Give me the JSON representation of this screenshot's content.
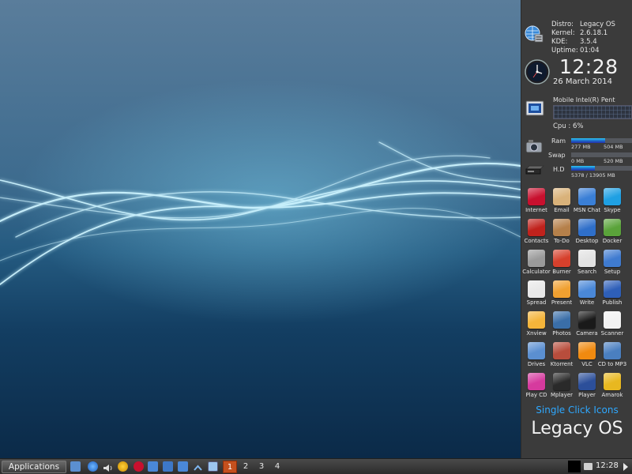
{
  "sysinfo": {
    "distro_label": "Distro:",
    "distro_value": "Legacy OS",
    "kernel_label": "Kernel:",
    "kernel_value": "2.6.18.1",
    "kde_label": "KDE:",
    "kde_value": "3.5.4",
    "uptime_label": "Uptime:",
    "uptime_value": "01:04"
  },
  "clock": {
    "time": "12:28",
    "date": "26 March 2014"
  },
  "cpu": {
    "name": "Mobile Intel(R) Pent",
    "label": "Cpu : 6%",
    "usage_percent": 6
  },
  "memory": {
    "ram": {
      "label": "Ram",
      "used": "277 MB",
      "total": "504 MB",
      "fraction": 0.55
    },
    "swap": {
      "label": "Swap",
      "used": "0 MB",
      "total": "520 MB",
      "fraction": 0.0
    },
    "hd": {
      "label": "H.D",
      "value": "5378 / 13905 MB",
      "fraction": 0.39
    }
  },
  "apps": [
    {
      "label": "Internet",
      "icon": "opera-icon",
      "color": "#c8102e"
    },
    {
      "label": "Email",
      "icon": "email-icon",
      "color": "#d9b27a"
    },
    {
      "label": "MSN Chat",
      "icon": "msn-icon",
      "color": "#3a7fd6"
    },
    {
      "label": "Skype",
      "icon": "skype-icon",
      "color": "#1fa0e3"
    },
    {
      "label": "Contacts",
      "icon": "contacts-icon",
      "color": "#c0221c"
    },
    {
      "label": "To-Do",
      "icon": "todo-icon",
      "color": "#b5804a"
    },
    {
      "label": "Desktop",
      "icon": "desktop-icon",
      "color": "#2f6fc9"
    },
    {
      "label": "Docker",
      "icon": "docker-icon",
      "color": "#5aa33a"
    },
    {
      "label": "Calculator",
      "icon": "calculator-icon",
      "color": "#9a9a9a"
    },
    {
      "label": "Burner",
      "icon": "burner-icon",
      "color": "#d6402c"
    },
    {
      "label": "Search",
      "icon": "search-icon",
      "color": "#e2e2e2"
    },
    {
      "label": "Setup",
      "icon": "setup-icon",
      "color": "#3f7bd0"
    },
    {
      "label": "Spread",
      "icon": "spreadsheet-icon",
      "color": "#e8e8e8"
    },
    {
      "label": "Present",
      "icon": "presentation-icon",
      "color": "#f0a030"
    },
    {
      "label": "Write",
      "icon": "write-icon",
      "color": "#4a88d8"
    },
    {
      "label": "Publish",
      "icon": "publish-icon",
      "color": "#2e5fb8"
    },
    {
      "label": "Xnview",
      "icon": "xnview-icon",
      "color": "#f4b43a"
    },
    {
      "label": "Photos",
      "icon": "photos-icon",
      "color": "#3a6ea8"
    },
    {
      "label": "Camera",
      "icon": "camera-icon",
      "color": "#1a1a1a"
    },
    {
      "label": "Scanner",
      "icon": "scanner-icon",
      "color": "#f2f2f2"
    },
    {
      "label": "Drives",
      "icon": "drives-icon",
      "color": "#5b8fd0"
    },
    {
      "label": "Ktorrent",
      "icon": "ktorrent-icon",
      "color": "#b84d3c"
    },
    {
      "label": "VLC",
      "icon": "vlc-icon",
      "color": "#f08a10"
    },
    {
      "label": "CD to MP3",
      "icon": "cd-to-mp3-icon",
      "color": "#4a7fc0"
    },
    {
      "label": "Play CD",
      "icon": "play-cd-icon",
      "color": "#d63a9e"
    },
    {
      "label": "Mplayer",
      "icon": "mplayer-icon",
      "color": "#2a2a2a"
    },
    {
      "label": "Player",
      "icon": "player-icon",
      "color": "#2c4f9a"
    },
    {
      "label": "Amarok",
      "icon": "amarok-icon",
      "color": "#e8b820"
    }
  ],
  "tagline": "Single Click Icons",
  "brand": "Legacy OS",
  "taskbar": {
    "applications_label": "Applications",
    "workspaces": [
      "1",
      "2",
      "3",
      "4"
    ],
    "active_workspace": "1",
    "clock": "12:28"
  }
}
